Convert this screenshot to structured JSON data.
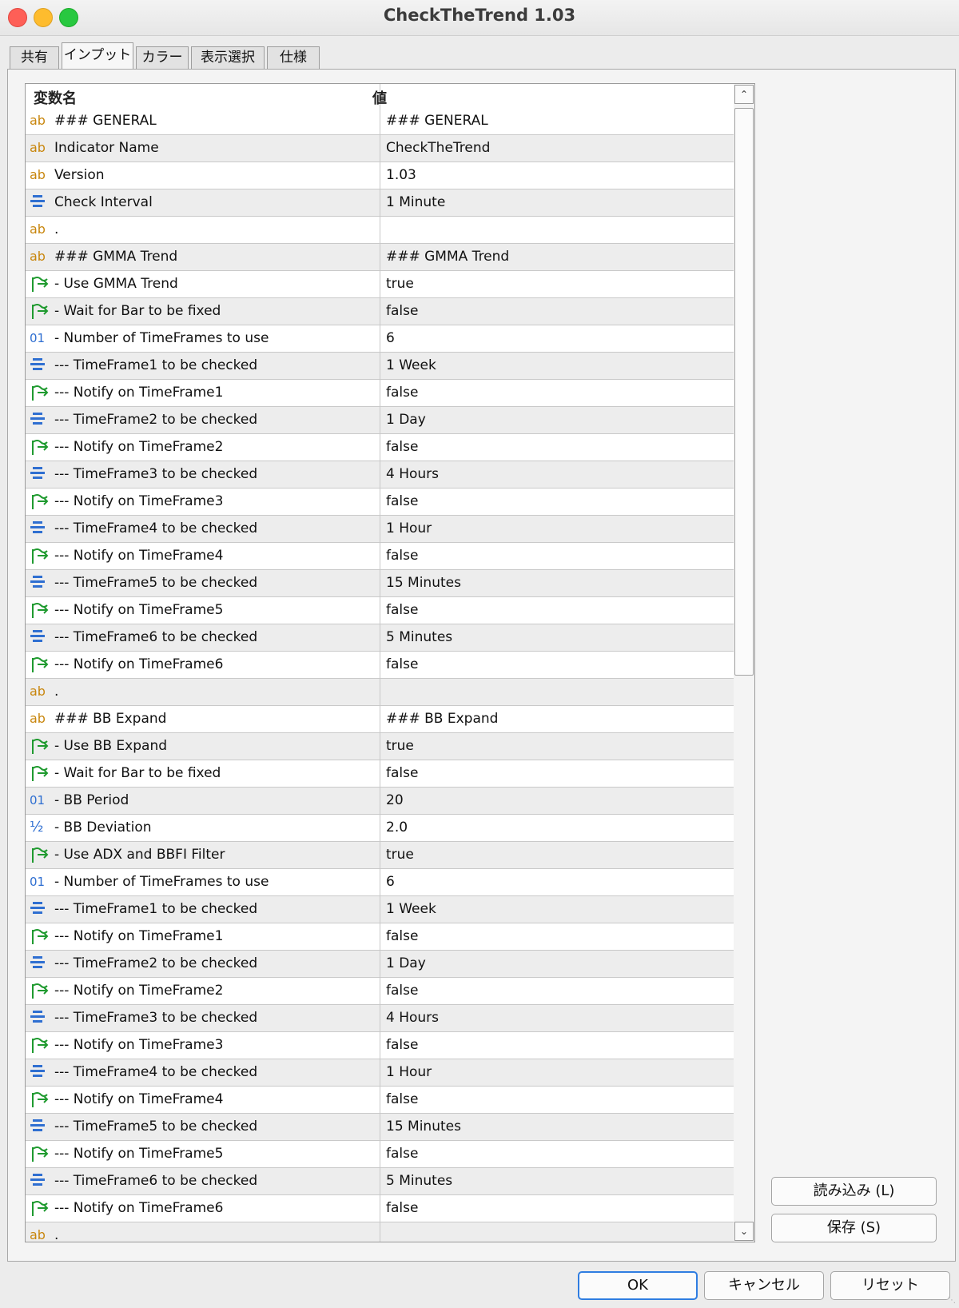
{
  "window": {
    "title": "CheckTheTrend 1.03",
    "controls": [
      "close-icon",
      "minimize-icon",
      "zoom-icon"
    ],
    "accent_color": "#2f7de1"
  },
  "tabs": [
    {
      "label": "共有",
      "active": false
    },
    {
      "label": "インプット",
      "active": true
    },
    {
      "label": "カラー",
      "active": false
    },
    {
      "label": "表示選択",
      "active": false
    },
    {
      "label": "仕様",
      "active": false
    }
  ],
  "table": {
    "headers": {
      "name": "変数名",
      "value": "値"
    },
    "type_icons": {
      "string": "ab",
      "enum": "≡",
      "bool": "↗",
      "int": "01",
      "double": "½"
    },
    "rows": [
      {
        "type": "string",
        "name": "### GENERAL",
        "value": "### GENERAL"
      },
      {
        "type": "string",
        "name": "Indicator Name",
        "value": "CheckTheTrend"
      },
      {
        "type": "string",
        "name": "Version",
        "value": "1.03"
      },
      {
        "type": "enum",
        "name": "Check Interval",
        "value": "1 Minute"
      },
      {
        "type": "string",
        "name": ".",
        "value": ""
      },
      {
        "type": "string",
        "name": "### GMMA Trend",
        "value": "### GMMA Trend"
      },
      {
        "type": "bool",
        "name": "- Use GMMA Trend",
        "value": "true"
      },
      {
        "type": "bool",
        "name": "- Wait for Bar to be fixed",
        "value": "false"
      },
      {
        "type": "int",
        "name": "- Number of TimeFrames to use",
        "value": "6"
      },
      {
        "type": "enum",
        "name": "--- TimeFrame1 to be checked",
        "value": "1 Week"
      },
      {
        "type": "bool",
        "name": "--- Notify on TimeFrame1",
        "value": "false"
      },
      {
        "type": "enum",
        "name": "--- TimeFrame2 to be checked",
        "value": "1 Day"
      },
      {
        "type": "bool",
        "name": "--- Notify on TimeFrame2",
        "value": "false"
      },
      {
        "type": "enum",
        "name": "--- TimeFrame3 to be checked",
        "value": "4 Hours"
      },
      {
        "type": "bool",
        "name": "--- Notify on TimeFrame3",
        "value": "false"
      },
      {
        "type": "enum",
        "name": "--- TimeFrame4 to be checked",
        "value": "1 Hour"
      },
      {
        "type": "bool",
        "name": "--- Notify on TimeFrame4",
        "value": "false"
      },
      {
        "type": "enum",
        "name": "--- TimeFrame5 to be checked",
        "value": "15 Minutes"
      },
      {
        "type": "bool",
        "name": "--- Notify on TimeFrame5",
        "value": "false"
      },
      {
        "type": "enum",
        "name": "--- TimeFrame6 to be checked",
        "value": "5 Minutes"
      },
      {
        "type": "bool",
        "name": "--- Notify on TimeFrame6",
        "value": "false"
      },
      {
        "type": "string",
        "name": ".",
        "value": ""
      },
      {
        "type": "string",
        "name": "### BB Expand",
        "value": "### BB Expand"
      },
      {
        "type": "bool",
        "name": "- Use BB Expand",
        "value": "true"
      },
      {
        "type": "bool",
        "name": "- Wait for Bar to be fixed",
        "value": "false"
      },
      {
        "type": "int",
        "name": "- BB Period",
        "value": "20"
      },
      {
        "type": "double",
        "name": "- BB Deviation",
        "value": "2.0"
      },
      {
        "type": "bool",
        "name": "- Use ADX and BBFI Filter",
        "value": "true"
      },
      {
        "type": "int",
        "name": "- Number of TimeFrames to use",
        "value": "6"
      },
      {
        "type": "enum",
        "name": "--- TimeFrame1 to be checked",
        "value": "1 Week"
      },
      {
        "type": "bool",
        "name": "--- Notify on TimeFrame1",
        "value": "false"
      },
      {
        "type": "enum",
        "name": "--- TimeFrame2 to be checked",
        "value": "1 Day"
      },
      {
        "type": "bool",
        "name": "--- Notify on TimeFrame2",
        "value": "false"
      },
      {
        "type": "enum",
        "name": "--- TimeFrame3 to be checked",
        "value": "4 Hours"
      },
      {
        "type": "bool",
        "name": "--- Notify on TimeFrame3",
        "value": "false"
      },
      {
        "type": "enum",
        "name": "--- TimeFrame4 to be checked",
        "value": "1 Hour"
      },
      {
        "type": "bool",
        "name": "--- Notify on TimeFrame4",
        "value": "false"
      },
      {
        "type": "enum",
        "name": "--- TimeFrame5 to be checked",
        "value": "15 Minutes"
      },
      {
        "type": "bool",
        "name": "--- Notify on TimeFrame5",
        "value": "false"
      },
      {
        "type": "enum",
        "name": "--- TimeFrame6 to be checked",
        "value": "5 Minutes"
      },
      {
        "type": "bool",
        "name": "--- Notify on TimeFrame6",
        "value": "false"
      },
      {
        "type": "string",
        "name": ".",
        "value": ""
      }
    ]
  },
  "side_buttons": {
    "load_label": "読み込み (L)",
    "save_label": "保存 (S)"
  },
  "footer_buttons": {
    "ok_label": "OK",
    "cancel_label": "キャンセル",
    "reset_label": "リセット"
  }
}
